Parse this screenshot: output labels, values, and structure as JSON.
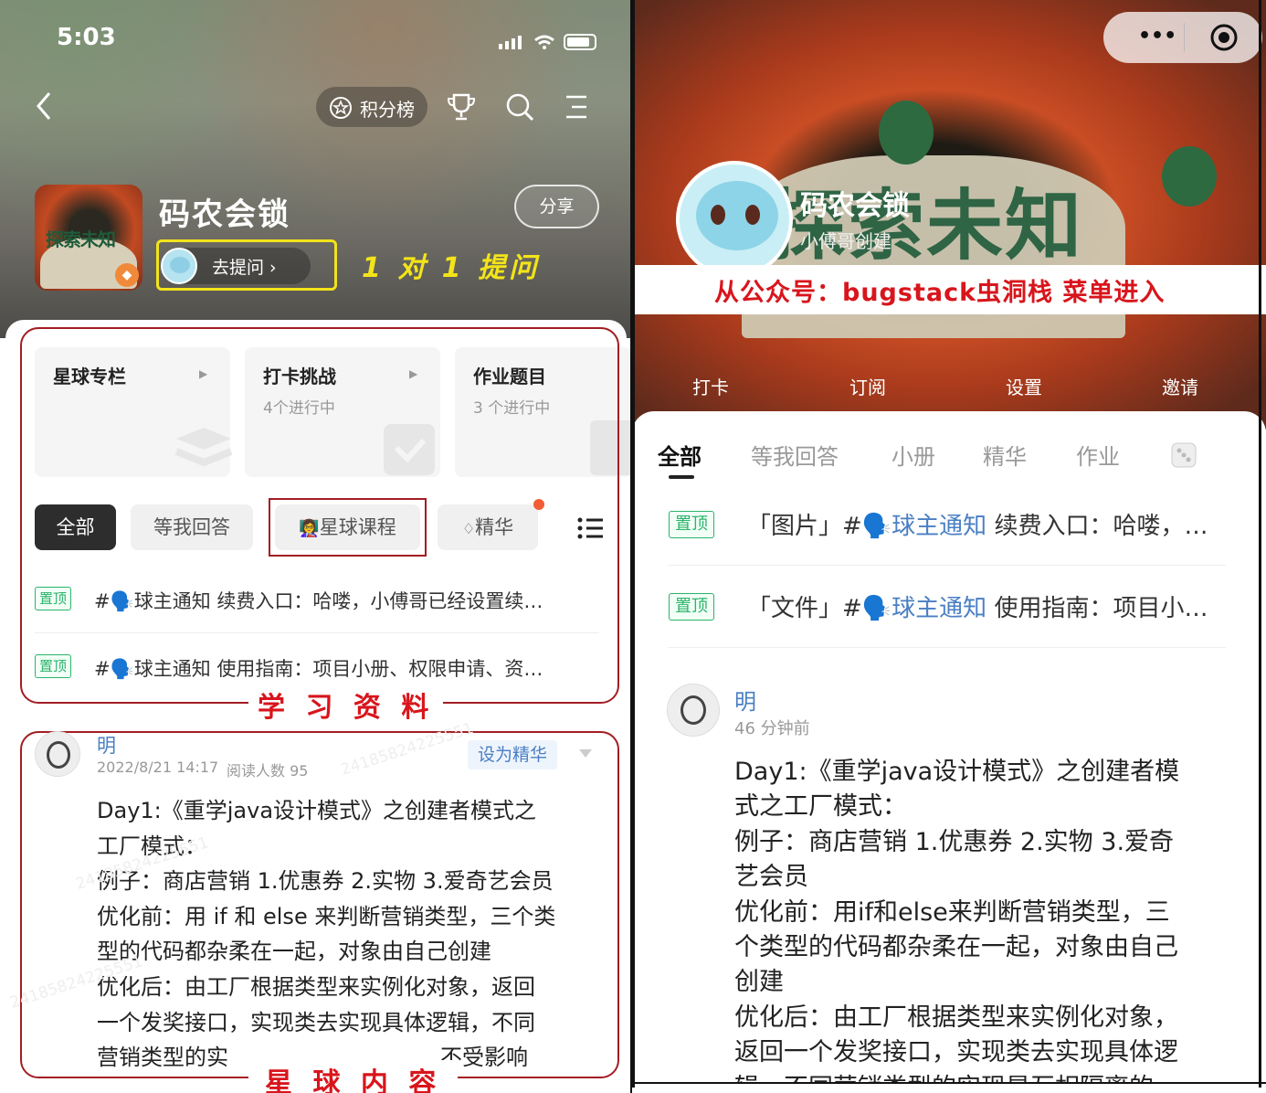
{
  "left": {
    "status": {
      "time": "5:03"
    },
    "nav": {
      "leaderboard": "积分榜"
    },
    "group": {
      "name": "码农会锁",
      "share": "分享",
      "ask": "去提问 ›",
      "badge_text": "探索未知"
    },
    "annotations": {
      "one_on_one": "1 对 1 提问",
      "study": "学 习 资 料",
      "content": "星 球 内 容"
    },
    "cards": [
      {
        "title": "星球专栏",
        "sub": ""
      },
      {
        "title": "打卡挑战",
        "sub": "4个进行中"
      },
      {
        "title": "作业题目",
        "sub": "3 个进行中"
      }
    ],
    "tabs": [
      "全部",
      "等我回答",
      "星球课程",
      "精华"
    ],
    "pinned": [
      {
        "tag": "置顶",
        "text": "#🗣️球主通知 续费入口：哈喽，小傅哥已经设置续…"
      },
      {
        "tag": "置顶",
        "text": "#🗣️球主通知 使用指南：项目小册、权限申请、资…"
      }
    ],
    "post": {
      "author": "明",
      "date": "2022/8/21 14:17",
      "reads": "阅读人数 95",
      "mark_featured": "设为精华",
      "body": [
        "Day1:《重学java设计模式》之创建者模式之",
        "工厂模式：",
        "例子：商店营销 1.优惠券 2.实物 3.爱奇艺会员",
        "优化前：用 if 和 else 来判断营销类型，三个类",
        "型的代码都杂柔在一起，对象由自己创建",
        "优化后：由工厂根据类型来实例化对象，返回",
        "一个发奖接口，实现类去实现具体逻辑，不同",
        "营销类型的实",
        "不受影响"
      ]
    },
    "watermarks": [
      "24185824225551",
      "24185824225551",
      "24185824225551"
    ]
  },
  "right": {
    "group": {
      "name": "码农会锁",
      "creator": "小傅哥创建",
      "source": "从公众号：bugstack虫洞栈 菜单进入",
      "banner_text": "探索未知"
    },
    "menu": [
      "打卡",
      "订阅",
      "设置",
      "邀请"
    ],
    "tabs": [
      "全部",
      "等我回答",
      "小册",
      "精华",
      "作业"
    ],
    "pinned": [
      {
        "tag": "置顶",
        "prefix": "「图片」#🗣️",
        "channel": "球主通知",
        "text": " 续费入口：哈喽，…"
      },
      {
        "tag": "置顶",
        "prefix": "「文件」#🗣️",
        "channel": "球主通知",
        "text": " 使用指南：项目小…"
      }
    ],
    "post": {
      "author": "明",
      "time": "46 分钟前",
      "body": [
        "Day1:《重学java设计模式》之创建者模",
        "式之工厂模式：",
        "例子：商店营销 1.优惠券 2.实物 3.爱奇",
        "艺会员",
        "优化前：用if和else来判断营销类型，三",
        "个类型的代码都杂柔在一起，对象由自己",
        "创建",
        "优化后：由工厂根据类型来实例化对象，",
        "返回一个发奖接口，实现类去实现具体逻",
        "辑，不同营销类型的实现是互相隔离的，"
      ]
    }
  },
  "colors": {
    "annotation_red": "#d8151c",
    "box_red": "#a31d23",
    "highlight_yellow": "#f3e41a",
    "pin_green": "#2bb36b",
    "link_blue": "#4a7fc3"
  }
}
